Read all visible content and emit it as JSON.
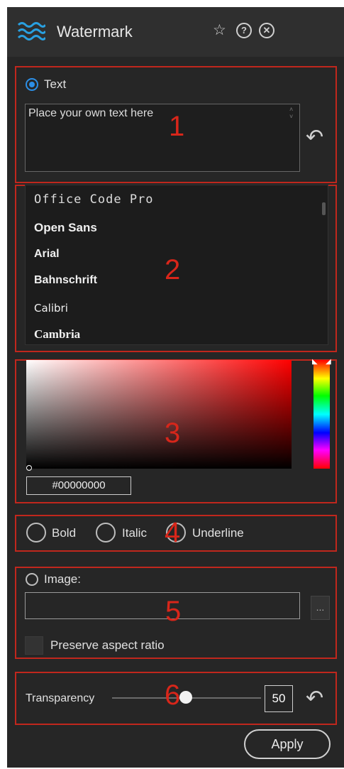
{
  "header": {
    "title": "Watermark",
    "logo_icon": "wave-logo-icon",
    "favorite_icon": "star-icon",
    "help_icon": "help-icon",
    "close_icon": "close-icon"
  },
  "text_section": {
    "label": "Text",
    "selected": true,
    "value": "Place your own text here"
  },
  "fonts": [
    "Office Code Pro",
    "Open Sans",
    "Arial",
    "Bahnschrift",
    "Calibri",
    "Cambria"
  ],
  "color": {
    "hex": "#00000000",
    "hue_color": "#ff0000"
  },
  "style_options": [
    {
      "label": "Bold",
      "checked": false
    },
    {
      "label": "Italic",
      "checked": false
    },
    {
      "label": "Underline",
      "checked": false
    }
  ],
  "image_section": {
    "label": "Image:",
    "selected": false,
    "path": "",
    "browse_label": "...",
    "preserve_label": "Preserve aspect ratio",
    "preserve_checked": false
  },
  "transparency": {
    "label": "Transparency",
    "value": "50",
    "fraction": 0.5
  },
  "apply_label": "Apply",
  "annotations": [
    "1",
    "2",
    "3",
    "4",
    "5",
    "6"
  ],
  "accent_color": "#2c8fe6",
  "annotation_color": "#c0271d"
}
